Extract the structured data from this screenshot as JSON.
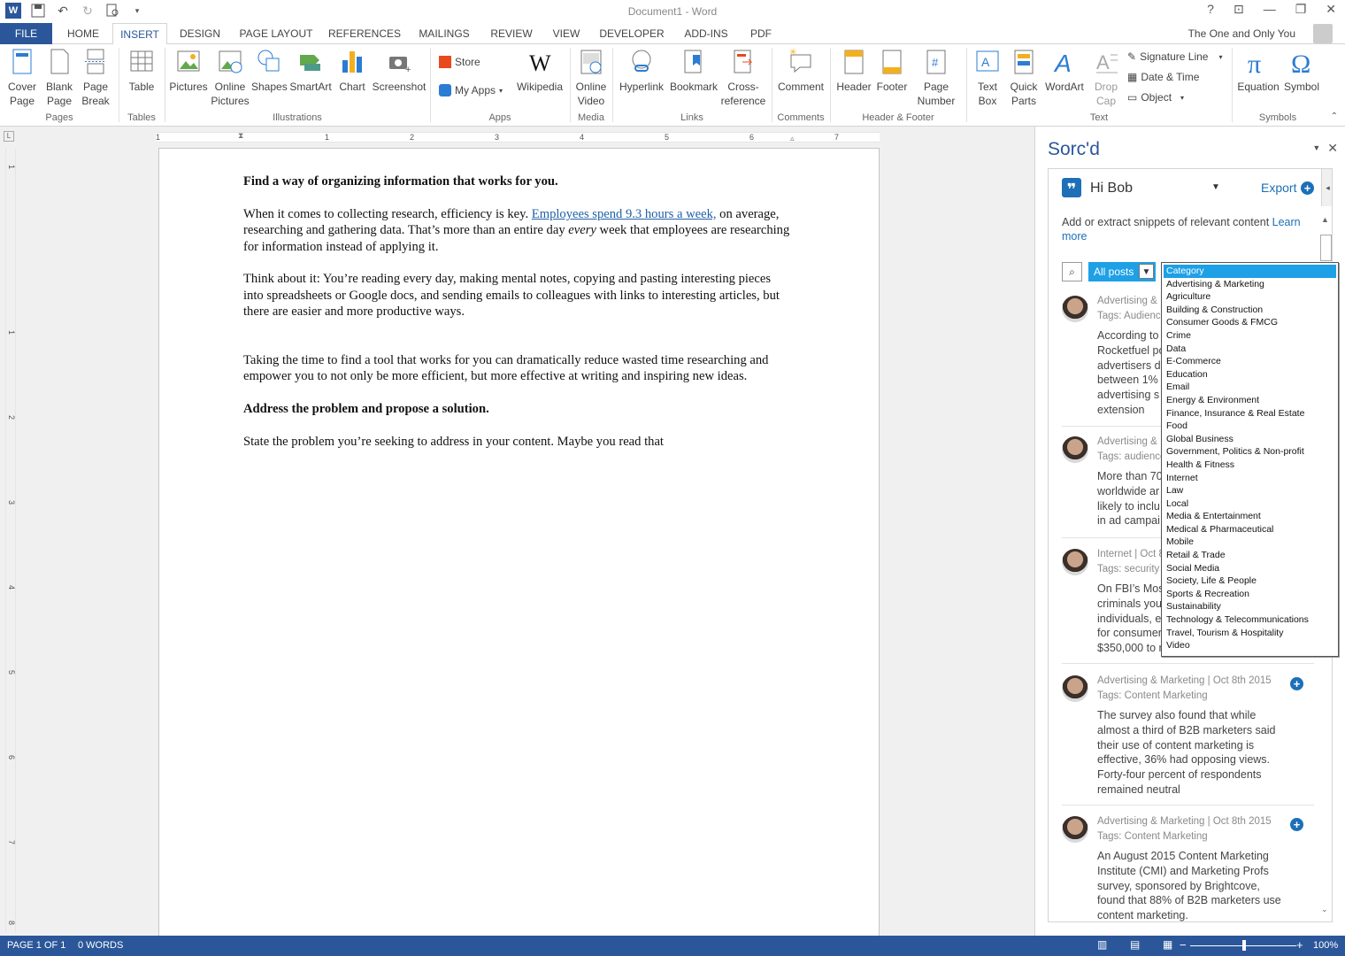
{
  "window": {
    "title": "Document1 - Word",
    "account": "The One and Only You"
  },
  "tabs": [
    {
      "label": "FILE"
    },
    {
      "label": "HOME"
    },
    {
      "label": "INSERT"
    },
    {
      "label": "DESIGN"
    },
    {
      "label": "PAGE LAYOUT"
    },
    {
      "label": "REFERENCES"
    },
    {
      "label": "MAILINGS"
    },
    {
      "label": "REVIEW"
    },
    {
      "label": "VIEW"
    },
    {
      "label": "DEVELOPER"
    },
    {
      "label": "ADD-INS"
    },
    {
      "label": "PDF"
    }
  ],
  "ribbon": {
    "buttons": {
      "cover_page": "Cover\nPage",
      "blank_page": "Blank\nPage",
      "page_break": "Page\nBreak",
      "table": "Table",
      "pictures": "Pictures",
      "online_pictures": "Online\nPictures",
      "shapes": "Shapes",
      "smartart": "SmartArt",
      "chart": "Chart",
      "screenshot": "Screenshot",
      "store": "Store",
      "my_apps": "My Apps",
      "wikipedia": "Wikipedia",
      "online_video": "Online\nVideo",
      "hyperlink": "Hyperlink",
      "bookmark": "Bookmark",
      "cross_reference": "Cross-\nreference",
      "comment": "Comment",
      "header": "Header",
      "footer": "Footer",
      "page_number": "Page\nNumber",
      "text_box": "Text\nBox",
      "quick_parts": "Quick\nParts",
      "wordart": "WordArt",
      "drop_cap": "Drop\nCap",
      "signature_line": "Signature Line",
      "date_time": "Date & Time",
      "object": "Object",
      "equation": "Equation",
      "symbol": "Symbol"
    },
    "groups": {
      "pages": "Pages",
      "tables": "Tables",
      "illustrations": "Illustrations",
      "apps": "Apps",
      "media": "Media",
      "links": "Links",
      "comments": "Comments",
      "header_footer": "Header & Footer",
      "text": "Text",
      "symbols": "Symbols"
    }
  },
  "ruler": {
    "h_numbers": [
      "1",
      "1",
      "2",
      "3",
      "4",
      "5",
      "6",
      "7"
    ],
    "v_numbers": [
      "1",
      "1",
      "2",
      "3",
      "4",
      "5",
      "6",
      "7",
      "8"
    ]
  },
  "document": {
    "p1": "Find a way of organizing information that works for you.",
    "p2_a": "When it comes to collecting research, efficiency is key. ",
    "p2_link": "Employees spend 9.3 hours a week,",
    "p2_b": " on average, researching and gathering data. That’s more than an entire day ",
    "p2_em": "every",
    "p2_c": " week that employees are researching for information instead of applying it.",
    "p3": "Think about it: You’re reading every day, making mental notes, copying and pasting interesting pieces into spreadsheets or Google docs, and sending emails to colleagues with links to interesting articles, but there are easier and more productive ways.",
    "p4": "Taking the time to find a tool that works for you can dramatically reduce wasted time researching and empower you to not only be more efficient, but more effective at writing and inspiring new ideas.",
    "p5": "Address the problem and propose a solution.",
    "p6": "State the problem you’re seeking to address in your content. Maybe you read that"
  },
  "pane": {
    "title": "Sorc'd",
    "greeting": "Hi Bob",
    "export": "Export",
    "description": "Add or extract snippets of relevant content ",
    "learn_more": "Learn more",
    "filter": "All posts",
    "posts": [
      {
        "meta": "Advertising &",
        "tags": "Tags: Audience",
        "text": "According to\nRocketfuel po\nadvertisers d\nbetween 1%\nadvertising s\nextension"
      },
      {
        "meta": "Advertising &",
        "tags": "Tags: audience",
        "text": "More than 70\nworldwide ar\nlikely to inclu\nin ad campai"
      },
      {
        "meta": "Internet | Oct 8",
        "tags": "Tags: security",
        "text": "On FBI’s Mos\ncriminals you\nindividuals, e\nfor consumer\n$350,000 to r"
      },
      {
        "meta": "Advertising & Marketing | Oct 8th 2015",
        "tags": "Tags: Content Marketing",
        "text": "The survey also found that while almost a third of B2B marketers said their use of content marketing is effective, 36% had opposing views. Forty-four percent of respondents remained neutral"
      },
      {
        "meta": "Advertising & Marketing | Oct 8th 2015",
        "tags": "Tags: Content Marketing",
        "text": "An August 2015 Content Marketing Institute (CMI) and Marketing Profs survey, sponsored by Brightcove, found that 88% of B2B marketers use content marketing."
      }
    ]
  },
  "category_dropdown": {
    "selected": "Category",
    "options": [
      "Advertising & Marketing",
      "Agriculture",
      "Building & Construction",
      "Consumer Goods & FMCG",
      "Crime",
      "Data",
      "E-Commerce",
      "Education",
      "Email",
      "Energy & Environment",
      "Finance, Insurance & Real Estate",
      "Food",
      "Global Business",
      "Government, Politics & Non-profit",
      "Health & Fitness",
      "Internet",
      "Law",
      "Local",
      "Media & Entertainment",
      "Medical & Pharmaceutical",
      "Mobile",
      "Retail & Trade",
      "Social Media",
      "Society, Life & People",
      "Sports & Recreation",
      "Sustainability",
      "Technology & Telecommunications",
      "Travel, Tourism & Hospitality",
      "Video"
    ]
  },
  "status": {
    "page": "PAGE 1 OF 1",
    "words": "0 WORDS",
    "zoom": "100%"
  },
  "colors": {
    "accent": "#2b579a",
    "pane_blue": "#1d6fb8",
    "dropdown_highlight": "#1ea0e6"
  }
}
